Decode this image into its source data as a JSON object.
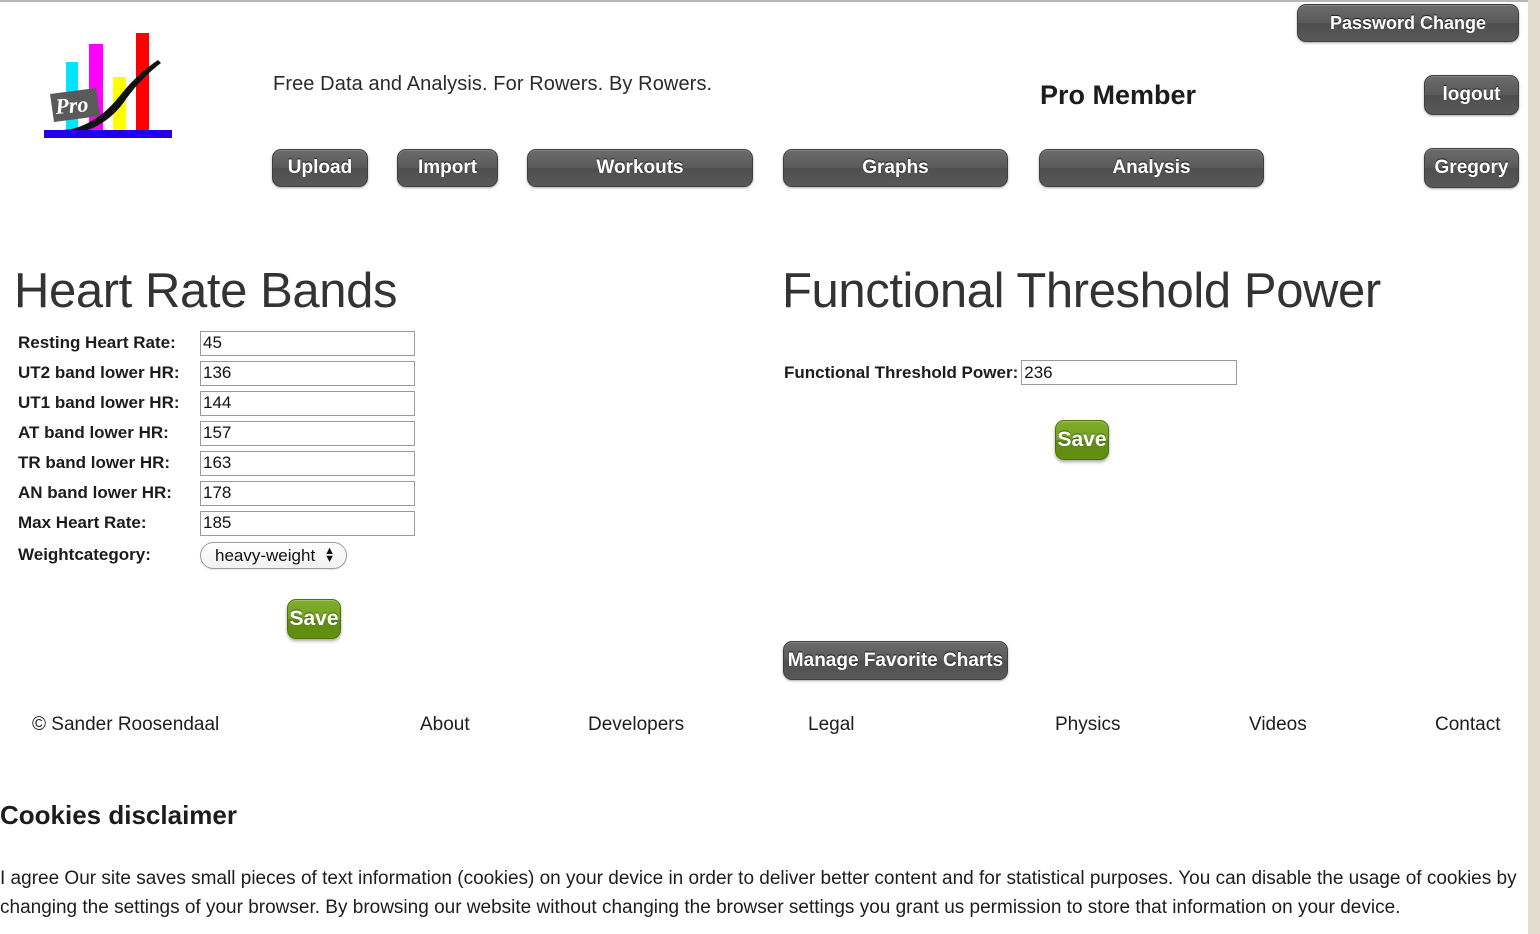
{
  "header": {
    "tagline": "Free Data and Analysis. For Rowers. By Rowers.",
    "membership": "Pro Member",
    "logo_alt": "Rowsandall Pro logo",
    "password_change_label": "Password Change",
    "logout_label": "logout",
    "user_label": "Gregory"
  },
  "nav": {
    "items": [
      {
        "label": "Upload"
      },
      {
        "label": "Import"
      },
      {
        "label": "Workouts"
      },
      {
        "label": "Graphs"
      },
      {
        "label": "Analysis"
      }
    ]
  },
  "heart_rate": {
    "title": "Heart Rate Bands",
    "fields": [
      {
        "label": "Resting Heart Rate:",
        "value": "45"
      },
      {
        "label": "UT2 band lower HR:",
        "value": "136"
      },
      {
        "label": "UT1 band lower HR:",
        "value": "144"
      },
      {
        "label": "AT band lower HR:",
        "value": "157"
      },
      {
        "label": "TR band lower HR:",
        "value": "163"
      },
      {
        "label": "AN band lower HR:",
        "value": "178"
      },
      {
        "label": "Max Heart Rate:",
        "value": "185"
      }
    ],
    "weight_category": {
      "label": "Weightcategory:",
      "selected": "heavy-weight"
    },
    "save_label": "Save"
  },
  "ftp": {
    "title": "Functional Threshold Power",
    "field_label": "Functional Threshold Power:",
    "value": "236",
    "save_label": "Save",
    "manage_charts_label": "Manage Favorite Charts"
  },
  "footer": {
    "copyright": "© Sander Roosendaal",
    "links": [
      {
        "label": "About"
      },
      {
        "label": "Developers"
      },
      {
        "label": "Legal"
      },
      {
        "label": "Physics"
      },
      {
        "label": "Videos"
      },
      {
        "label": "Contact"
      }
    ]
  },
  "cookies": {
    "title": "Cookies disclaimer",
    "agree_label": "I agree",
    "body": " Our site saves small pieces of text information (cookies) on your device in order to deliver better content and for statistical purposes. You can disable the usage of cookies by changing the settings of your browser. By browsing our website without changing the browser settings you grant us permission to store that information on your device."
  },
  "colors": {
    "button_dark": "#5a5a5a",
    "button_save_green": "#74a024",
    "page_background": "#ffffff",
    "right_gutter": "#e5dcd0",
    "logo_cyan": "#00e5ff",
    "logo_magenta": "#ff00ff",
    "logo_yellow": "#ffff00",
    "logo_red": "#ff0000",
    "logo_blue": "#2200ee"
  }
}
